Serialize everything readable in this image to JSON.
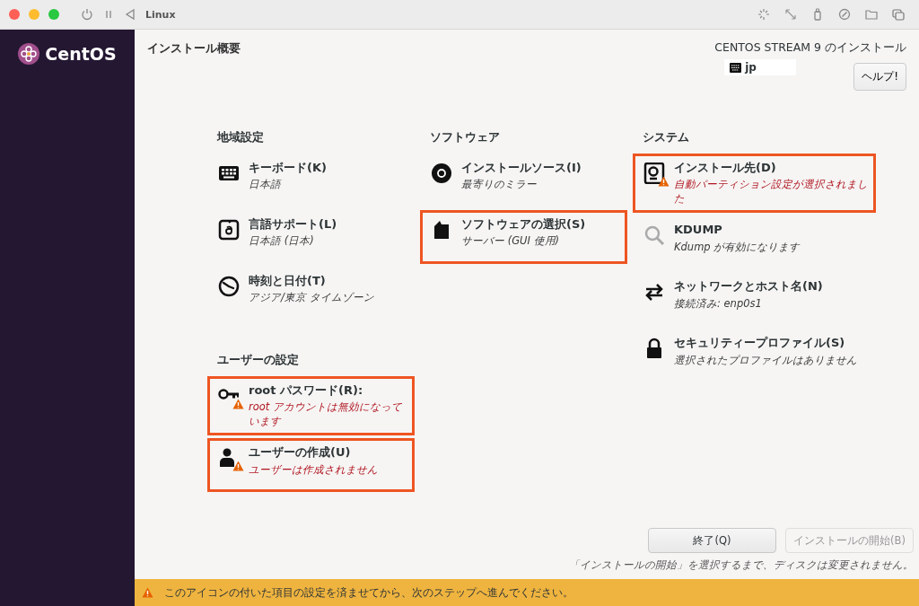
{
  "window": {
    "title": "Linux"
  },
  "sidebar": {
    "logo_text": "CentOS"
  },
  "header": {
    "title": "インストール概要",
    "product": "CENTOS STREAM 9 のインストール",
    "keyboard_layout": "jp",
    "help_button": "ヘルプ!"
  },
  "columns": [
    {
      "categories": [
        {
          "title": "地域設定",
          "spokes": [
            {
              "kind": "keyboard",
              "title": "キーボード(K)",
              "status": "日本語",
              "warning": false,
              "highlighted": false
            },
            {
              "kind": "language",
              "title": "言語サポート(L)",
              "status": "日本語 (日本)",
              "warning": false,
              "highlighted": false
            },
            {
              "kind": "clock",
              "title": "時刻と日付(T)",
              "status": "アジア/東京 タイムゾーン",
              "warning": false,
              "highlighted": false
            }
          ]
        },
        {
          "title": "ユーザーの設定",
          "spokes": [
            {
              "kind": "key",
              "title": "root パスワード(R):",
              "status": "root アカウントは無効になっています",
              "warning": true,
              "highlighted": true
            },
            {
              "kind": "user",
              "title": "ユーザーの作成(U)",
              "status": "ユーザーは作成されません",
              "warning": true,
              "highlighted": true
            }
          ]
        }
      ]
    },
    {
      "categories": [
        {
          "title": "ソフトウェア",
          "spokes": [
            {
              "kind": "disc",
              "title": "インストールソース(I)",
              "status": "最寄りのミラー",
              "warning": false,
              "highlighted": false
            },
            {
              "kind": "package",
              "title": "ソフトウェアの選択(S)",
              "status": "サーバー (GUI 使用)",
              "warning": false,
              "highlighted": true
            }
          ]
        }
      ]
    },
    {
      "categories": [
        {
          "title": "システム",
          "spokes": [
            {
              "kind": "disk",
              "title": "インストール先(D)",
              "status": "自動パーティション設定が選択されました",
              "warning": true,
              "highlighted": true
            },
            {
              "kind": "magnifier",
              "title": "KDUMP",
              "status": "Kdump が有効になります",
              "warning": false,
              "highlighted": false
            },
            {
              "kind": "arrows",
              "title": "ネットワークとホスト名(N)",
              "status": "接続済み: enp0s1",
              "warning": false,
              "highlighted": false
            },
            {
              "kind": "lock",
              "title": "セキュリティープロファイル(S)",
              "status": "選択されたプロファイルはありません",
              "warning": false,
              "highlighted": false
            }
          ]
        }
      ]
    }
  ],
  "buttons": [
    {
      "label": "終了(Q)",
      "disabled": false
    },
    {
      "label": "インストールの開始(B)",
      "disabled": true
    }
  ],
  "note": "「インストールの開始」を選択するまで、ディスクは変更されません。",
  "warning_bar": {
    "text": "このアイコンの付いた項目の設定を済ませてから、次のステップへ進んでください。"
  }
}
